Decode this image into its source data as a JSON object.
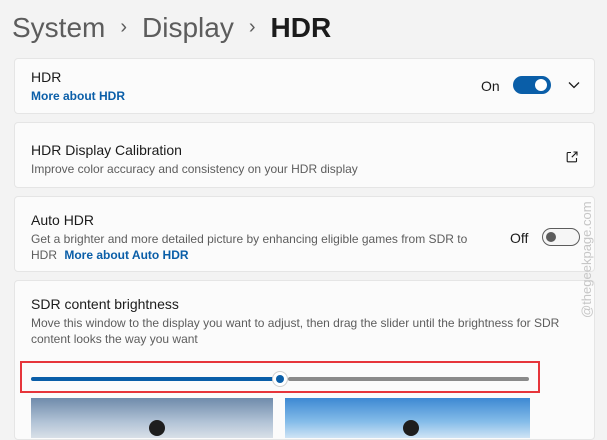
{
  "breadcrumb": {
    "items": [
      "System",
      "Display",
      "HDR"
    ]
  },
  "hdr": {
    "title": "HDR",
    "link": "More about HDR",
    "state": "On",
    "on": true
  },
  "calibration": {
    "title": "HDR Display Calibration",
    "description": "Improve color accuracy and consistency on your HDR display",
    "icon": "external-link-icon"
  },
  "auto_hdr": {
    "title": "Auto HDR",
    "description_line1": "Get a brighter and more detailed picture by enhancing eligible games from SDR to",
    "description_line2": "HDR",
    "link": "More about Auto HDR",
    "state": "Off",
    "on": false
  },
  "sdr": {
    "title": "SDR content brightness",
    "description_line1": "Move this window to the display you want to adjust, then drag the slider until the brightness for SDR",
    "description_line2": "content looks the way you want",
    "slider_value_fraction": 0.5
  },
  "watermark": "@thegeekpage.com",
  "colors": {
    "accent": "#0a5ea8",
    "highlight": "#e6353b"
  }
}
